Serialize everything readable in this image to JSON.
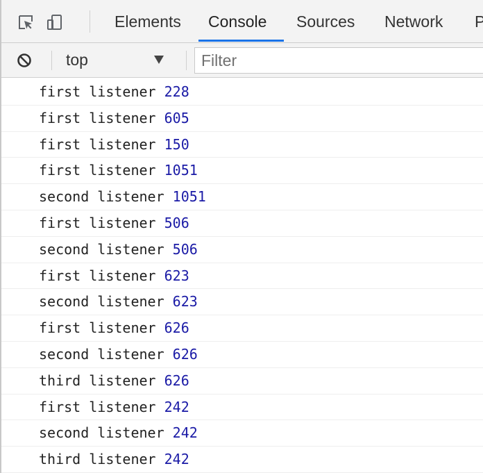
{
  "tabs": [
    {
      "label": "Elements"
    },
    {
      "label": "Console"
    },
    {
      "label": "Sources"
    },
    {
      "label": "Network"
    },
    {
      "label": "P"
    }
  ],
  "active_tab": "Console",
  "toolbar": {
    "context": "top",
    "filter_placeholder": "Filter"
  },
  "icons": {
    "inspect": "inspect-element-icon",
    "device": "device-toolbar-icon",
    "clear": "clear-console-icon",
    "dropdown": "dropdown-triangle-icon"
  },
  "colors": {
    "accent": "#1a73e8",
    "number": "#1a1aa6",
    "text": "#222222",
    "toolbar_bg": "#f3f3f3"
  },
  "logs": [
    {
      "msg": "first listener",
      "num": "228"
    },
    {
      "msg": "first listener",
      "num": "605"
    },
    {
      "msg": "first listener",
      "num": "150"
    },
    {
      "msg": "first listener",
      "num": "1051"
    },
    {
      "msg": "second listener",
      "num": "1051"
    },
    {
      "msg": "first listener",
      "num": "506"
    },
    {
      "msg": "second listener",
      "num": "506"
    },
    {
      "msg": "first listener",
      "num": "623"
    },
    {
      "msg": "second listener",
      "num": "623"
    },
    {
      "msg": "first listener",
      "num": "626"
    },
    {
      "msg": "second listener",
      "num": "626"
    },
    {
      "msg": "third listener",
      "num": "626"
    },
    {
      "msg": "first listener",
      "num": "242"
    },
    {
      "msg": "second listener",
      "num": "242"
    },
    {
      "msg": "third listener",
      "num": "242"
    }
  ]
}
